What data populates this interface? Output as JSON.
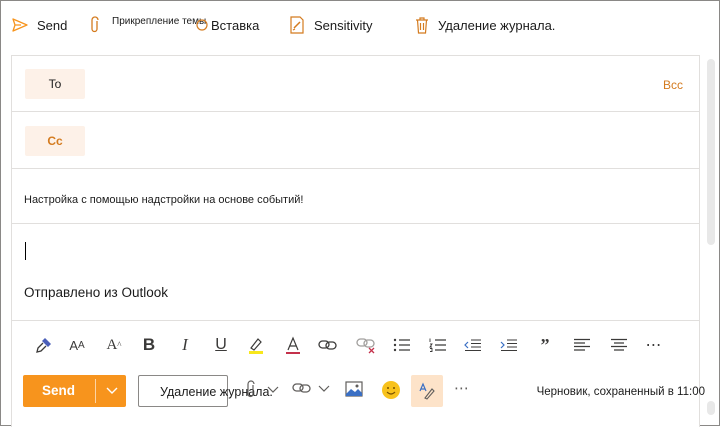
{
  "ribbon": {
    "send_label": "Send",
    "attach_label": "Прикрепление темы",
    "insert_label": "Вставка",
    "sensitivity_label": "Sensitivity",
    "discard_label": "Удаление журнала."
  },
  "compose": {
    "to_label": "To",
    "cc_label": "Cc",
    "bcc_label": "Bcc",
    "subject": "Настройка с помощью надстройки на основе событий!",
    "signature": "Отправлено из Outlook"
  },
  "format_toolbar": {
    "icons": [
      "format-painter-icon",
      "font-size-icon",
      "font-grow-icon",
      "bold-icon",
      "italic-icon",
      "underline-icon",
      "highlight-icon",
      "font-color-icon",
      "link-icon",
      "unlink-icon",
      "bullets-icon",
      "numbering-icon",
      "decrease-indent-icon",
      "increase-indent-icon",
      "quote-icon",
      "align-left-icon",
      "align-center-icon",
      "more-icon"
    ]
  },
  "bottom_bar": {
    "send_label": "Send",
    "discard_label": "Удаление журнала.",
    "status": "Черновик, сохраненный в 11:00"
  },
  "colors": {
    "accent": "#F7941D",
    "accent_text": "#D47B1F",
    "pill_bg": "#FDF1E8",
    "editor_bg": "#FDE3C9"
  }
}
